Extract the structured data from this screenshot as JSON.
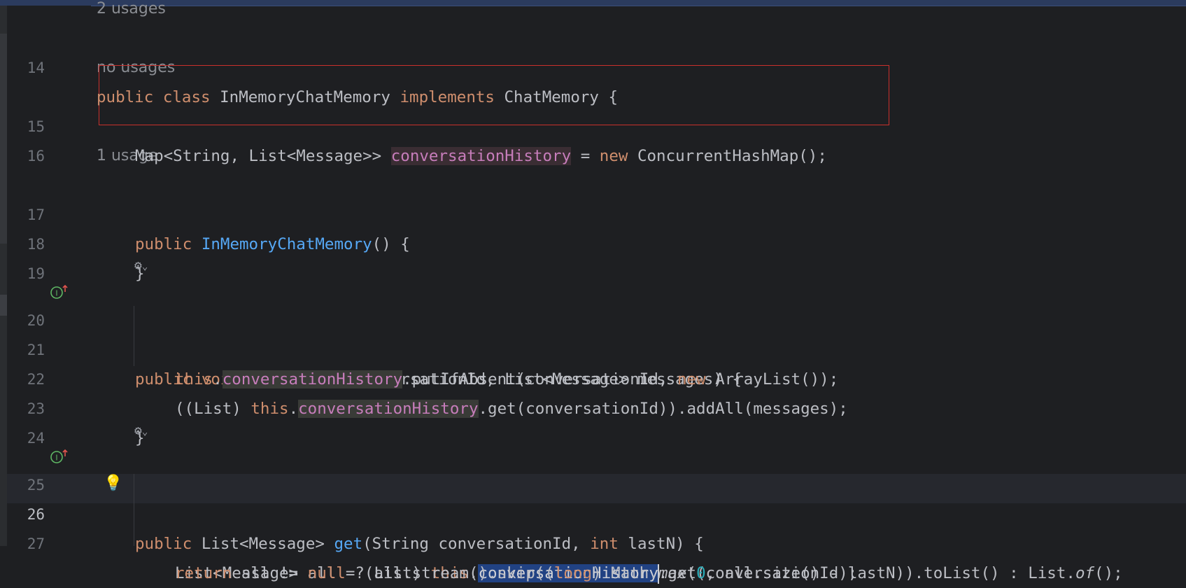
{
  "hints": {
    "top_usages": "2 usages",
    "field_usages": "no usages",
    "ctor_usages": "1 usage"
  },
  "gutter": {
    "line_numbers": [
      "14",
      "15",
      "16",
      "17",
      "18",
      "19",
      "20",
      "21",
      "22",
      "23",
      "24",
      "25",
      "26",
      "27"
    ]
  },
  "code": {
    "l14": {
      "kw1": "public",
      "kw2": "class",
      "name": "InMemoryChatMemory",
      "kw3": "implements",
      "iface": "ChatMemory",
      "brace": "{"
    },
    "l15": {
      "type": "Map<String, List<Message>>",
      "field": "conversationHistory",
      "eq": "=",
      "kw": "new",
      "rest": "ConcurrentHashMap();"
    },
    "l17": {
      "kw": "public",
      "name": "InMemoryChatMemory",
      "rest": "() {"
    },
    "l18": {
      "text": "}"
    },
    "l20": {
      "kw1": "public",
      "kw2": "void",
      "name": "add",
      "rest": "(String conversationId, List<Message> messages) {"
    },
    "l21": {
      "kw": "this",
      "dot": ".",
      "field": "conversationHistory",
      "mid": ".putIfAbsent(conversationId, ",
      "kw2": "new",
      "rest": "ArrayList());"
    },
    "l22": {
      "pre": "((List) ",
      "kw": "this",
      "dot": ".",
      "field": "conversationHistory",
      "rest": ".get(conversationId)).addAll(messages);"
    },
    "l23": {
      "text": "}"
    },
    "l25": {
      "kw1": "public",
      "type": "List<Message>",
      "name": "get",
      "rest1": "(String conversationId, ",
      "kw2": "int",
      "rest2": "lastN) {"
    },
    "l26": {
      "pre": "List<Message> all = (List) ",
      "kw": "this",
      "dot": ".",
      "field": "conversationHistory",
      "rest": ".get(conversationId);"
    },
    "l27": {
      "kw1": "return",
      "a": "all != ",
      "kw2": "null",
      "b": "? all.stream().skip((",
      "kw3": "long",
      "c": ") Math.",
      "max": "max",
      "d": "(",
      "zero": "0",
      "e": ", all.size() - lastN)).toList() : List.",
      "of": "of",
      "f": "();"
    }
  },
  "colors": {
    "background": "#1e1f22",
    "keyword": "#cf8e6d",
    "field": "#c77dbb",
    "method": "#56a8f5",
    "number": "#2aacb8",
    "selection": "#214283",
    "highlight_box": "#c9302c"
  },
  "icons": {
    "implements_marker": "implements-icon",
    "ai_assistant": "ai-assistant-icon",
    "intention_bulb": "lightbulb-icon"
  }
}
